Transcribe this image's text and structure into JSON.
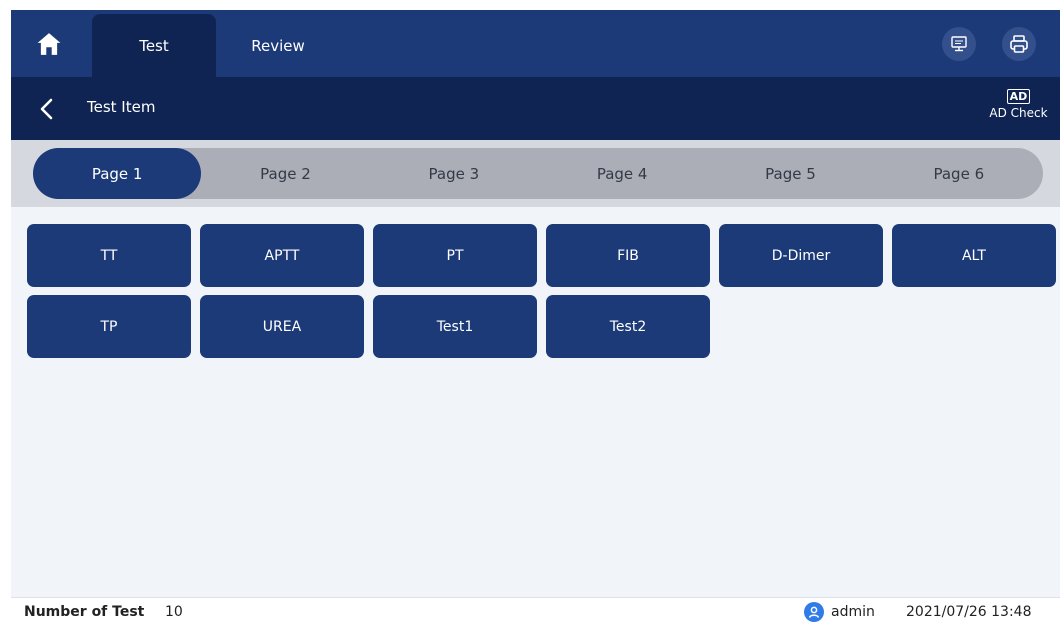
{
  "nav": {
    "tabs": [
      {
        "label": "Test",
        "active": true
      },
      {
        "label": "Review",
        "active": false
      }
    ],
    "home_icon": "home-icon",
    "lis_icon": "lis-monitor-icon",
    "print_icon": "printer-icon"
  },
  "subheader": {
    "title": "Test Item",
    "ad_badge": "AD",
    "ad_label": "AD Check"
  },
  "pages": {
    "tabs": [
      "Page 1",
      "Page 2",
      "Page 3",
      "Page 4",
      "Page 5",
      "Page 6"
    ],
    "active": "Page 1"
  },
  "items": [
    "TT",
    "APTT",
    "PT",
    "FIB",
    "D-Dimer",
    "ALT",
    "TP",
    "UREA",
    "Test1",
    "Test2"
  ],
  "footer": {
    "count_label": "Number of Test",
    "count_value": "10",
    "user": "admin",
    "datetime": "2021/07/26 13:48"
  },
  "colors": {
    "primary": "#1c3a77",
    "dark": "#0f2452",
    "page_bg": "#f1f5fa",
    "user_icon": "#2f7ce8"
  }
}
